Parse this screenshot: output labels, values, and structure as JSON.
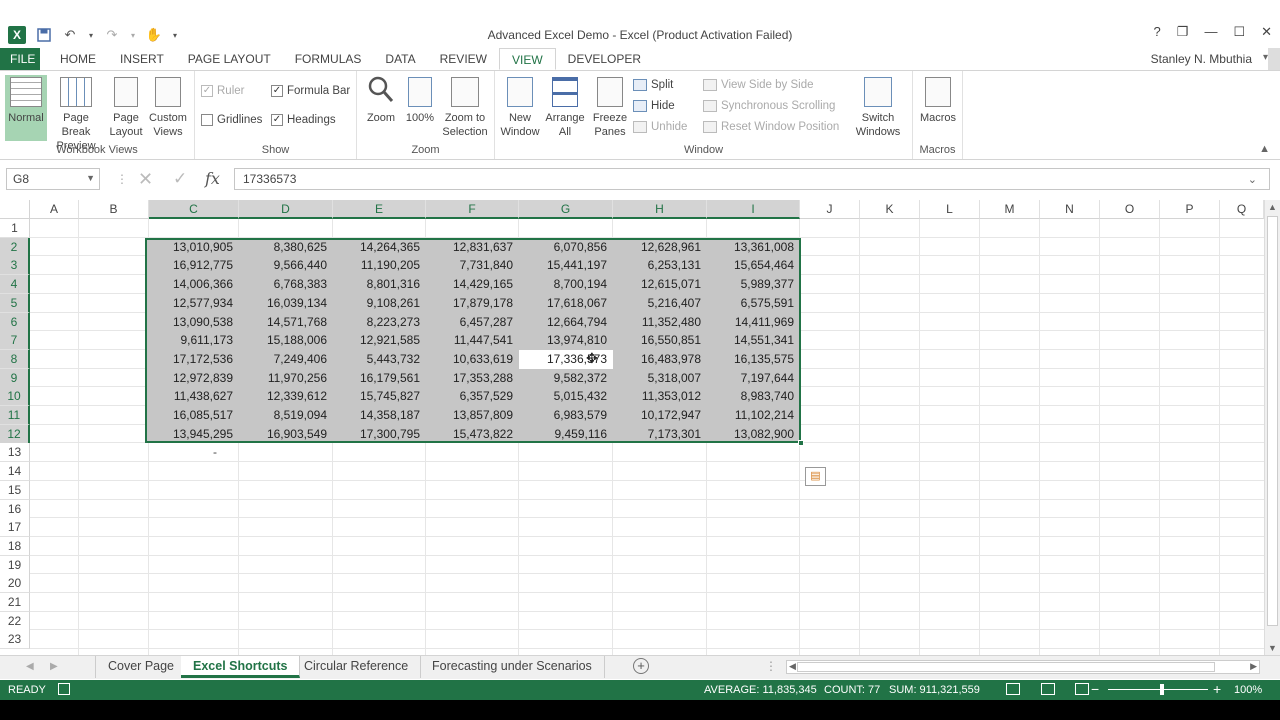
{
  "window": {
    "title": "Advanced Excel Demo - Excel (Product Activation Failed)",
    "controls": [
      "?",
      "❐",
      "—",
      "☐",
      "✕"
    ],
    "user": "Stanley N. Mbuthia"
  },
  "tabs": [
    "FILE",
    "HOME",
    "INSERT",
    "PAGE LAYOUT",
    "FORMULAS",
    "DATA",
    "REVIEW",
    "VIEW",
    "DEVELOPER"
  ],
  "active_tab": "VIEW",
  "ribbon": {
    "workbook_views": {
      "label": "Workbook Views",
      "normal": "Normal",
      "page_break_1": "Page Break",
      "page_break_2": "Preview",
      "page_layout_1": "Page",
      "page_layout_2": "Layout",
      "custom_views_1": "Custom",
      "custom_views_2": "Views"
    },
    "show": {
      "label": "Show",
      "ruler": "Ruler",
      "formula_bar": "Formula Bar",
      "gridlines": "Gridlines",
      "headings": "Headings"
    },
    "zoom": {
      "label": "Zoom",
      "zoom": "Zoom",
      "hundred": "100%",
      "zoom_sel_1": "Zoom to",
      "zoom_sel_2": "Selection"
    },
    "window": {
      "label": "Window",
      "new_window_1": "New",
      "new_window_2": "Window",
      "arrange_1": "Arrange",
      "arrange_2": "All",
      "freeze_1": "Freeze",
      "freeze_2": "Panes",
      "split": "Split",
      "hide": "Hide",
      "unhide": "Unhide",
      "side_by_side": "View Side by Side",
      "sync_scroll": "Synchronous Scrolling",
      "reset_pos": "Reset Window Position",
      "switch_1": "Switch",
      "switch_2": "Windows"
    },
    "macros": {
      "label": "Macros",
      "macros": "Macros"
    }
  },
  "formula_bar": {
    "name_box": "G8",
    "formula": "17336573",
    "fx": "fx"
  },
  "columns": [
    "A",
    "B",
    "C",
    "D",
    "E",
    "F",
    "G",
    "H",
    "I",
    "J",
    "K",
    "L",
    "M",
    "N",
    "O",
    "P",
    "Q"
  ],
  "rows": [
    "1",
    "2",
    "3",
    "4",
    "5",
    "6",
    "7",
    "8",
    "9",
    "10",
    "11",
    "12",
    "13",
    "14",
    "15",
    "16",
    "17",
    "18",
    "19",
    "20",
    "21",
    "22",
    "23"
  ],
  "cells": [
    [
      "13,010,905",
      "8,380,625",
      "14,264,365",
      "12,831,637",
      "6,070,856",
      "12,628,961",
      "13,361,008"
    ],
    [
      "16,912,775",
      "9,566,440",
      "11,190,205",
      "7,731,840",
      "15,441,197",
      "6,253,131",
      "15,654,464"
    ],
    [
      "14,006,366",
      "6,768,383",
      "8,801,316",
      "14,429,165",
      "8,700,194",
      "12,615,071",
      "5,989,377"
    ],
    [
      "12,577,934",
      "16,039,134",
      "9,108,261",
      "17,879,178",
      "17,618,067",
      "5,216,407",
      "6,575,591"
    ],
    [
      "13,090,538",
      "14,571,768",
      "8,223,273",
      "6,457,287",
      "12,664,794",
      "11,352,480",
      "14,411,969"
    ],
    [
      "9,611,173",
      "15,188,006",
      "12,921,585",
      "11,447,541",
      "13,974,810",
      "16,550,851",
      "14,551,341"
    ],
    [
      "17,172,536",
      "7,249,406",
      "5,443,732",
      "10,633,619",
      "17,336,573",
      "16,483,978",
      "16,135,575"
    ],
    [
      "12,972,839",
      "11,970,256",
      "16,179,561",
      "17,353,288",
      "9,582,372",
      "5,318,007",
      "7,197,644"
    ],
    [
      "11,438,627",
      "12,339,612",
      "15,745,827",
      "6,357,529",
      "5,015,432",
      "11,353,012",
      "8,983,740"
    ],
    [
      "16,085,517",
      "8,519,094",
      "14,358,187",
      "13,857,809",
      "6,983,579",
      "10,172,947",
      "11,102,214"
    ],
    [
      "13,945,295",
      "16,903,549",
      "17,300,795",
      "15,473,822",
      "9,459,116",
      "7,173,301",
      "13,082,900"
    ]
  ],
  "c13_value": "-",
  "sheets": [
    "Cover Page",
    "Excel Shortcuts",
    "Circular Reference",
    "Forecasting under Scenarios"
  ],
  "active_sheet": "Excel Shortcuts",
  "status": {
    "ready": "READY",
    "average": "AVERAGE: 11,835,345",
    "count": "COUNT: 77",
    "sum": "SUM: 911,321,559",
    "zoom": "100%"
  },
  "colors": {
    "accent": "#217346",
    "selection": "#c6c6c6"
  }
}
